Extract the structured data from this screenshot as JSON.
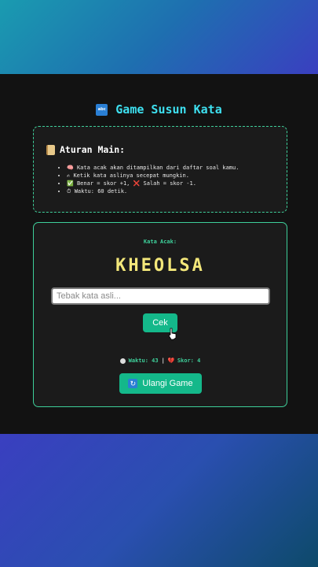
{
  "header": {
    "title": "Game Susun Kata",
    "title_icon_label": "abc",
    "title_icon": "abc-icon"
  },
  "rules": {
    "title": "Aturan Main:",
    "title_icon": "scroll-icon",
    "items": [
      {
        "icon": "brain-icon",
        "emoji": "🧠",
        "text": "Kata acak akan ditampilkan dari daftar soal kamu."
      },
      {
        "icon": "writing-hand-icon",
        "emoji": "✍",
        "text": "Ketik kata aslinya secepat mungkin."
      },
      {
        "icon": "check-icon",
        "emoji": "✅",
        "text": "Benar = skor +1, ❌ Salah = skor -1."
      },
      {
        "icon": "stopwatch-icon",
        "emoji": "⏱",
        "text": "Waktu: 60 detik."
      }
    ]
  },
  "game": {
    "label": "Kata Acak:",
    "scrambled_word": "KHEOLSA",
    "input_placeholder": "Tebak kata asli...",
    "input_value": "",
    "check_label": "Cek",
    "time_text": "Waktu: 43",
    "separator": "|",
    "score_text": "Skor: 4",
    "reset_label": "Ulangi Game"
  },
  "colors": {
    "accent": "#3ecf9a",
    "title": "#3ee0f0",
    "word": "#f3e77a",
    "button": "#14b88a"
  }
}
